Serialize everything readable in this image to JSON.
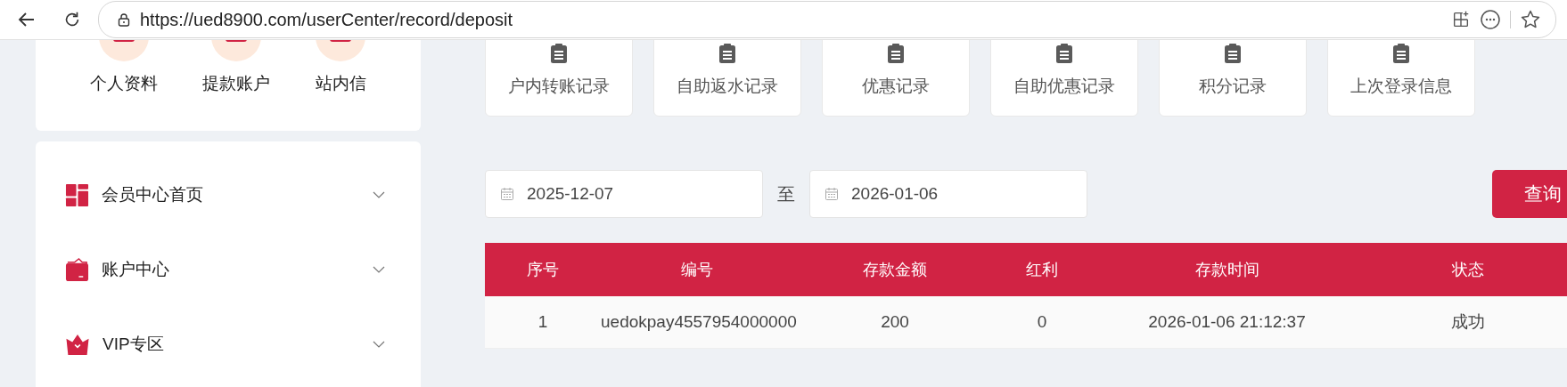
{
  "browser": {
    "url": "https://ued8900.com/userCenter/record/deposit"
  },
  "profile_shortcuts": [
    {
      "label": "个人资料"
    },
    {
      "label": "提款账户"
    },
    {
      "label": "站内信"
    }
  ],
  "menu": [
    {
      "kind": "dashboard",
      "label": "会员中心首页",
      "expanded": false
    },
    {
      "kind": "wallet",
      "label": "账户中心",
      "expanded": false
    },
    {
      "kind": "crown",
      "label": "VIP专区",
      "expanded": false
    }
  ],
  "record_tabs": [
    {
      "label": "户内转账记录"
    },
    {
      "label": "自助返水记录"
    },
    {
      "label": "优惠记录"
    },
    {
      "label": "自助优惠记录"
    },
    {
      "label": "积分记录"
    },
    {
      "label": "上次登录信息"
    }
  ],
  "filter": {
    "start_date": "2025-12-07",
    "separator": "至",
    "end_date": "2026-01-06",
    "button": "查询"
  },
  "table": {
    "columns": [
      "序号",
      "编号",
      "存款金额",
      "红利",
      "存款时间",
      "状态"
    ],
    "rows": [
      [
        "1",
        "uedokpay4557954000000",
        "200",
        "0",
        "2026-01-06 21:12:37",
        "成功"
      ]
    ]
  }
}
